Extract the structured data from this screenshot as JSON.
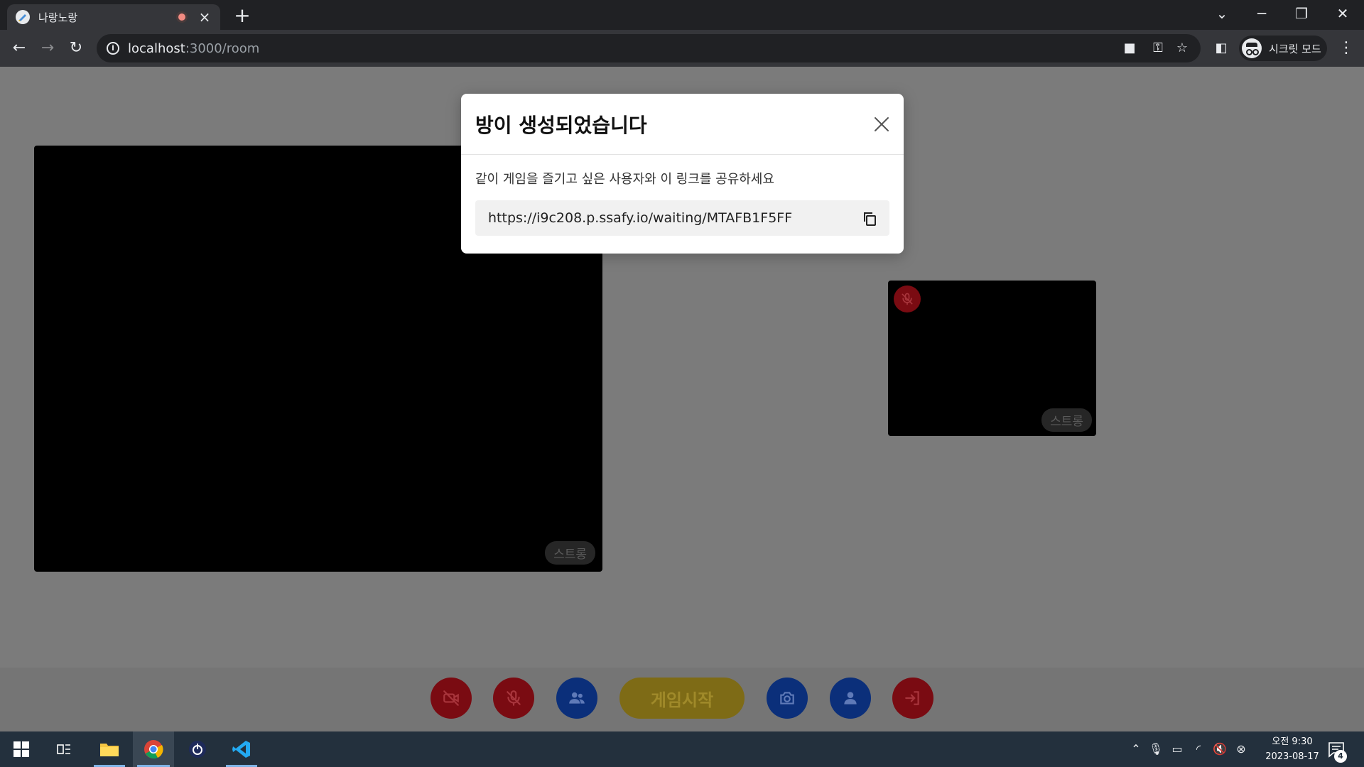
{
  "browser": {
    "tab_title": "나랑노랑",
    "tab_close": "×",
    "new_tab": "+",
    "url_host": "localhost",
    "url_path": ":3000/room",
    "incognito_label": "시크릿 모드",
    "window_controls": {
      "dropdown": "⌄",
      "minimize": "─",
      "restore": "❐",
      "close": "✕"
    }
  },
  "modal": {
    "title": "방이 생성되었습니다",
    "description": "같이 게임을 즐기고 싶은 사용자와 이 링크를 공유하세요",
    "link": "https://i9c208.p.ssafy.io/waiting/MTAFB1F5FF"
  },
  "videos": {
    "main_name": "스트롱",
    "small_name": "스트롱"
  },
  "controls": {
    "start_label": "게임시작"
  },
  "taskbar": {
    "time": "오전 9:30",
    "date": "2023-08-17",
    "notification_count": "4"
  },
  "colors": {
    "page_background": "#7b7b7b",
    "control_red": "#7a0b12",
    "control_blue": "#0b2f7a",
    "start_button": "#7e6b16"
  }
}
